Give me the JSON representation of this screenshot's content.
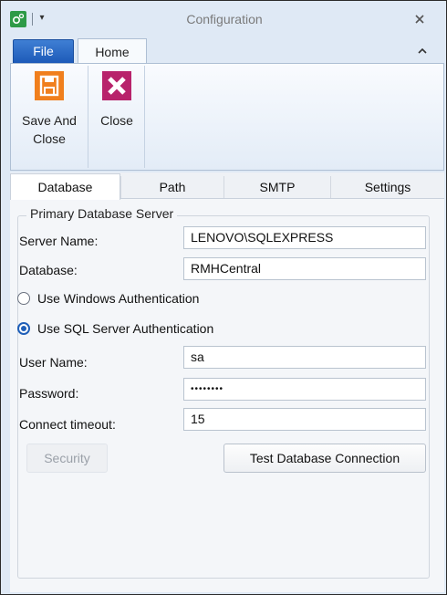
{
  "window": {
    "title": "Configuration",
    "accent": "#1d5ab8"
  },
  "quick_access": {
    "icon": "gear-app-icon",
    "dropdown_glyph": "▾"
  },
  "ribbon": {
    "tabs": [
      {
        "label": "File"
      },
      {
        "label": "Home"
      }
    ],
    "buttons": [
      {
        "label_line1": "Save And",
        "label_line2": "Close",
        "icon": "floppy-disk-icon",
        "icon_color": "#f07f1d"
      },
      {
        "label_line1": "Close",
        "icon": "close-x-icon",
        "icon_color": "#b8236b"
      }
    ]
  },
  "tabs": [
    {
      "label": "Database",
      "active": true
    },
    {
      "label": "Path"
    },
    {
      "label": "SMTP"
    },
    {
      "label": "Settings"
    }
  ],
  "database": {
    "group_title": "Primary Database Server",
    "server_name_label": "Server Name:",
    "server_name_value": "LENOVO\\SQLEXPRESS",
    "database_label": "Database:",
    "database_value": "RMHCentral",
    "auth_options": [
      {
        "label": "Use Windows Authentication",
        "selected": false
      },
      {
        "label": "Use SQL Server Authentication",
        "selected": true
      }
    ],
    "user_name_label": "User Name:",
    "user_name_value": "sa",
    "password_label": "Password:",
    "password_value": "••••••••",
    "timeout_label": "Connect timeout:",
    "timeout_value": "15",
    "security_button": "Security",
    "test_button": "Test Database Connection"
  }
}
